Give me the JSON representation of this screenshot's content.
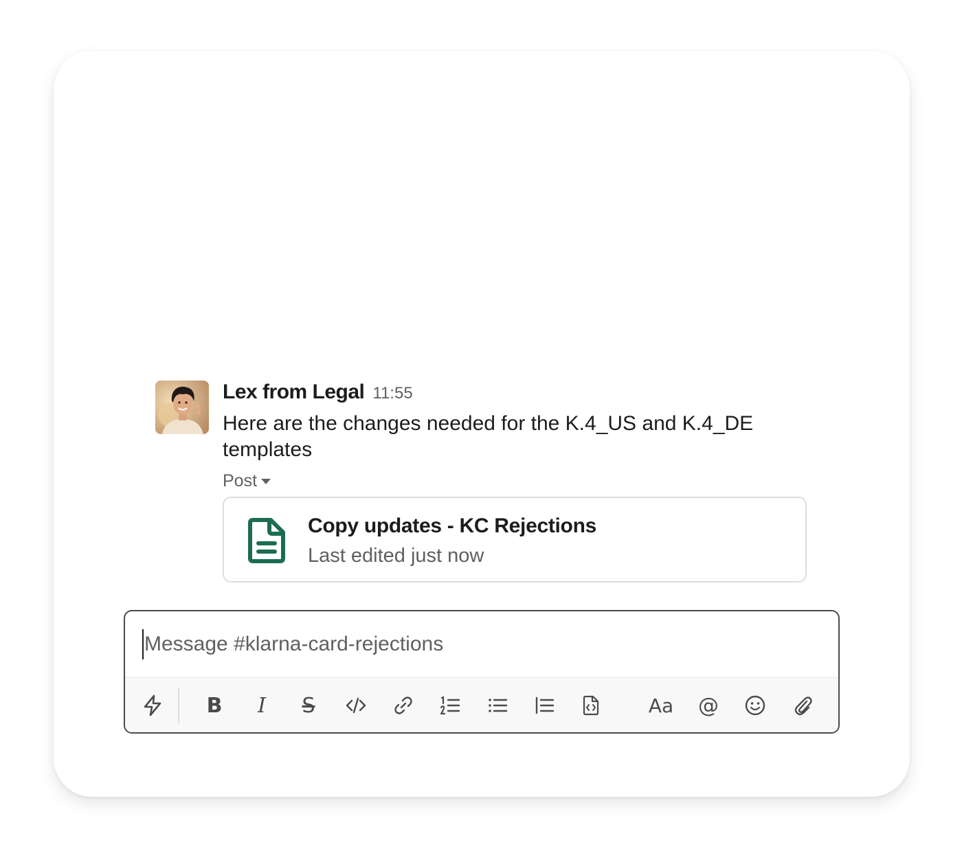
{
  "message": {
    "author": "Lex from Legal",
    "time": "11:55",
    "text": "Here are the changes needed for the K.4_US and K.4_DE templates",
    "post_label": "Post"
  },
  "attachment": {
    "title": "Copy updates - KC Rejections",
    "subtitle": "Last edited just now",
    "icon": "document-icon",
    "icon_color": "#1b6d50"
  },
  "composer": {
    "placeholder": "Message #klarna-card-rejections",
    "value": ""
  },
  "toolbar": {
    "shortcuts": "lightning-icon",
    "bold": "B",
    "italic": "I",
    "strikethrough": "S",
    "code": "code-icon",
    "link": "link-icon",
    "ordered_list": "ordered-list-icon",
    "bulleted_list": "bulleted-list-icon",
    "blockquote": "blockquote-icon",
    "code_block": "code-block-icon",
    "format_text": "Aa",
    "mention": "@",
    "emoji": "emoji-icon",
    "attach": "paperclip-icon"
  }
}
